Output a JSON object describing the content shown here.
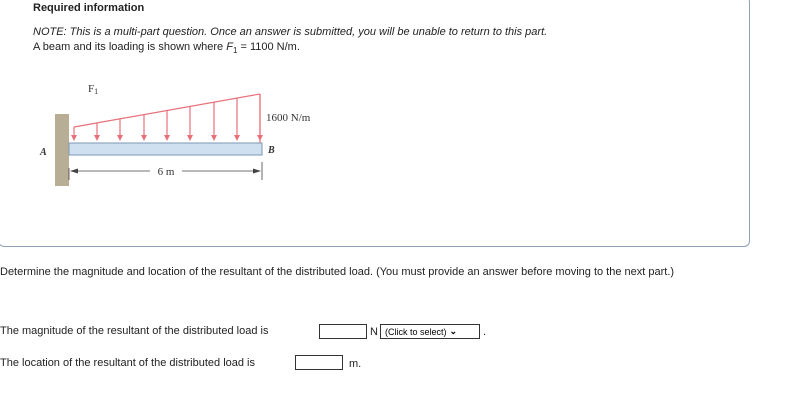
{
  "header": {
    "title": "Required information",
    "note": "NOTE: This is a multi-part question. Once an answer is submitted, you will be unable to return to this part.",
    "description_prefix": "A beam and its loading is shown where ",
    "f1_symbol": "F",
    "f1_subscript": "1",
    "description_suffix": " = 1100 N/m."
  },
  "figure": {
    "label_f1": "F",
    "label_f1_sub": "1",
    "label_load": "1600 N/m",
    "label_a": "A",
    "label_b": "B",
    "label_length": "6 m"
  },
  "question": {
    "text": "Determine the magnitude and location of the resultant of the distributed load. (You must provide an answer before moving to the next part.)"
  },
  "answers": {
    "magnitude_label": "The magnitude of the resultant of the distributed load is",
    "magnitude_value": "",
    "magnitude_unit": "N",
    "direction_select": "(Click to select)",
    "period": ".",
    "location_label": "The location of the resultant of the distributed load is",
    "location_value": "",
    "location_unit": "m."
  },
  "colors": {
    "load_arrow": "#e8707a",
    "beam_fill": "#cfe0f0",
    "wall_fill": "#b8ad95"
  }
}
